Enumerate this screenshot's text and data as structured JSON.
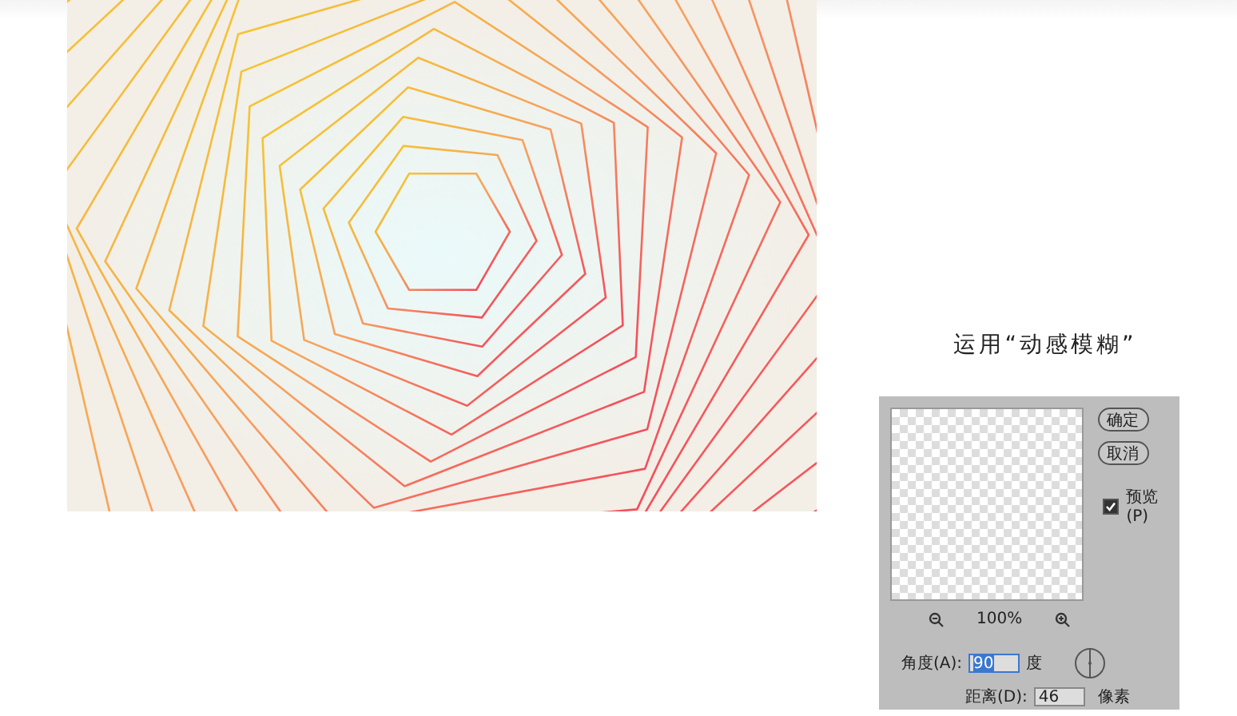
{
  "caption": "运用“动感模糊”",
  "dialog": {
    "buttons": [
      "确定",
      "取消"
    ],
    "preview": {
      "label": "预览(P)",
      "checked": true
    },
    "zoom": "100%",
    "angle": {
      "label": "角度(A):",
      "value": "90",
      "unit": "度",
      "selected": true
    },
    "distance": {
      "label": "距离(D):",
      "value": "46",
      "unit": "像素"
    }
  }
}
